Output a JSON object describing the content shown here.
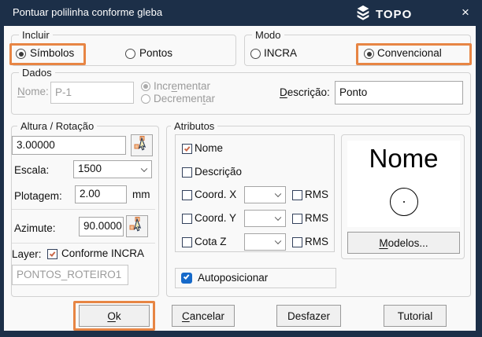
{
  "window": {
    "title": "Pontuar polilinha conforme gleba",
    "brand": "TOPO",
    "close_glyph": "×"
  },
  "incluir": {
    "legend": "Incluir",
    "simbolos": "Símbolos",
    "pontos": "Pontos"
  },
  "modo": {
    "legend": "Modo",
    "incra": "INCRA",
    "convencional": "Convencional"
  },
  "dados": {
    "legend": "Dados",
    "nome_label": {
      "u": "N",
      "post": "ome:"
    },
    "nome_value": "P-1",
    "incrementar": {
      "pre": "Incr",
      "u": "e",
      "post": "mentar"
    },
    "decrementar": {
      "pre": "Decremen",
      "u": "t",
      "post": "ar"
    },
    "descricao_label": {
      "u": "D",
      "post": "escrição:"
    },
    "descricao_value": "Ponto"
  },
  "altura": {
    "legend": "Altura / Rotação",
    "altura_value": "3.00000",
    "escala_label": "Escala:",
    "escala_value": "1500",
    "plotagem_label": "Plotagem:",
    "plotagem_value": "2.00",
    "plotagem_unit": "mm",
    "azimute_label": "Azimute:",
    "azimute_value": "90.0000",
    "layer_label": "Layer:",
    "layer_check_label": "Conforme INCRA",
    "layer_value": "PONTOS_ROTEIRO1"
  },
  "atributos": {
    "legend": "Atributos",
    "nome": "Nome",
    "descricao": "Descrição",
    "coord_x": "Coord. X",
    "coord_y": "Coord. Y",
    "cota_z": "Cota Z",
    "rms": "RMS",
    "autoposicionar": "Autoposicionar",
    "preview_text": "Nome",
    "modelos": {
      "u": "M",
      "post": "odelos..."
    }
  },
  "buttons": {
    "ok": {
      "u": "O",
      "post": "k"
    },
    "cancelar": {
      "u": "C",
      "post": "ancelar"
    },
    "desfazer": "Desfazer",
    "tutorial": "Tutorial"
  },
  "colors": {
    "titlebar": "#1c2f48",
    "highlight_orange": "#e78544",
    "check_warm": "#c9684a",
    "check_blue": "#1669c9"
  }
}
